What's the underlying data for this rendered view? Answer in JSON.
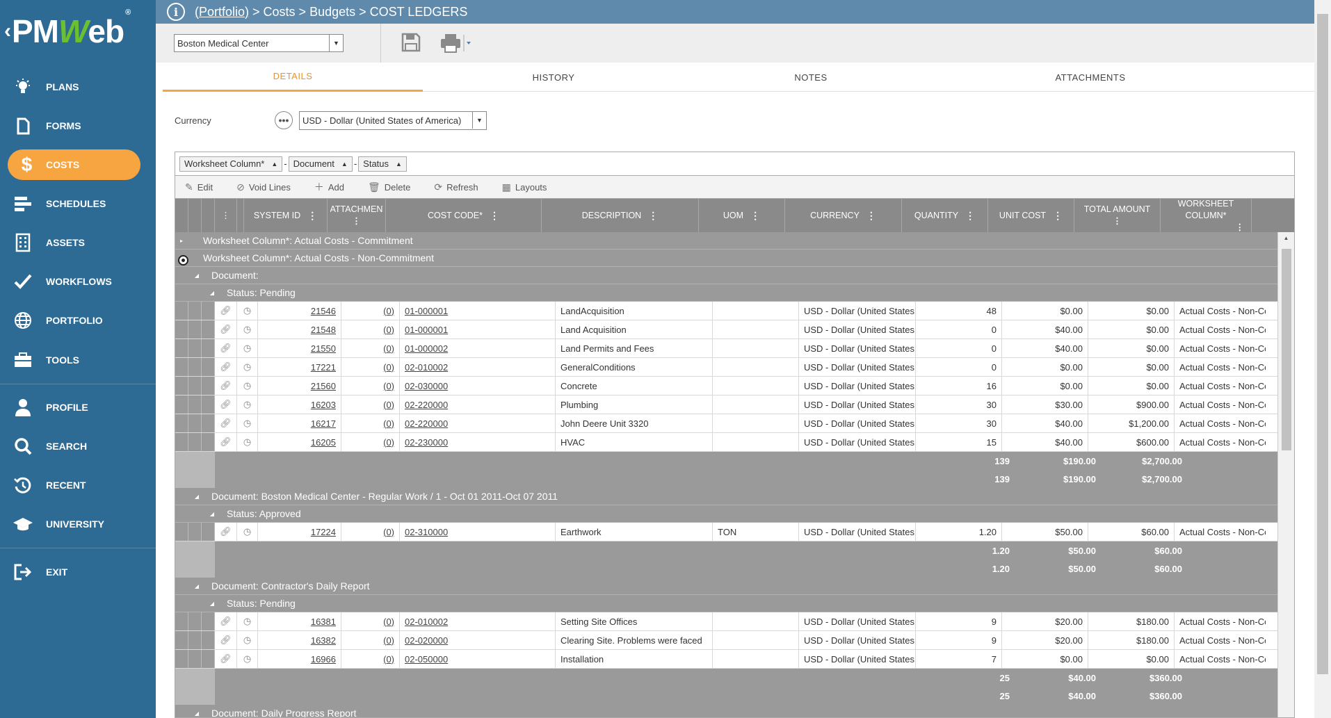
{
  "sidebar": {
    "logo": {
      "prefix": "PM",
      "accent": "W",
      "suffix": "eb",
      "reg": "®"
    },
    "items": [
      {
        "label": "PLANS",
        "icon": "lightbulb-icon"
      },
      {
        "label": "FORMS",
        "icon": "document-icon"
      },
      {
        "label": "COSTS",
        "icon": "dollar-icon",
        "active": true
      },
      {
        "label": "SCHEDULES",
        "icon": "schedule-bars-icon"
      },
      {
        "label": "ASSETS",
        "icon": "building-icon"
      },
      {
        "label": "WORKFLOWS",
        "icon": "checkmark-icon"
      },
      {
        "label": "PORTFOLIO",
        "icon": "globe-icon"
      },
      {
        "label": "TOOLS",
        "icon": "briefcase-icon"
      },
      {
        "label": "PROFILE",
        "icon": "person-icon"
      },
      {
        "label": "SEARCH",
        "icon": "search-icon"
      },
      {
        "label": "RECENT",
        "icon": "history-icon"
      },
      {
        "label": "UNIVERSITY",
        "icon": "graduation-cap-icon"
      },
      {
        "label": "EXIT",
        "icon": "exit-icon"
      }
    ]
  },
  "breadcrumb": {
    "portfolio": "(Portfolio)",
    "rest": " > Costs > Budgets > COST LEDGERS"
  },
  "toolbar": {
    "project": "Boston Medical Center"
  },
  "tabs": [
    "DETAILS",
    "HISTORY",
    "NOTES",
    "ATTACHMENTS"
  ],
  "currency": {
    "label": "Currency",
    "value": "USD - Dollar (United States of America)"
  },
  "grid": {
    "group_chips": [
      "Worksheet Column*",
      "Document",
      "Status"
    ],
    "actions": [
      "Edit",
      "Void Lines",
      "Add",
      "Delete",
      "Refresh",
      "Layouts"
    ],
    "columns": [
      "SYSTEM ID",
      "ATTACHMENTS",
      "COST CODE*",
      "DESCRIPTION",
      "UOM",
      "CURRENCY",
      "QUANTITY",
      "UNIT COST",
      "TOTAL AMOUNT",
      "WORKSHEET COLUMN*"
    ],
    "groups": {
      "ws1": "Worksheet Column*: Actual Costs - Commitment",
      "ws2": "Worksheet Column*: Actual Costs - Non-Commitment",
      "doc1": "Document:",
      "st1": "Status: Pending",
      "doc2": "Document: Boston Medical Center - Regular Work / 1 - Oct 01 2011-Oct 07 2011",
      "st2": "Status: Approved",
      "doc3": "Document: Contractor's Daily Report",
      "st3": "Status: Pending",
      "doc4": "Document: Daily Progress Report"
    },
    "section1": [
      {
        "id": "21546",
        "att": "(0)",
        "code": "01-000001",
        "desc": "LandAcquisition",
        "uom": "",
        "cur": "USD - Dollar (United States of America)",
        "qty": "48",
        "unit": "$0.00",
        "total": "$0.00",
        "ws": "Actual Costs - Non-Commitment"
      },
      {
        "id": "21548",
        "att": "(0)",
        "code": "01-000001",
        "desc": "Land Acquisition",
        "uom": "",
        "cur": "USD - Dollar (United States of America)",
        "qty": "0",
        "unit": "$40.00",
        "total": "$0.00",
        "ws": "Actual Costs - Non-Commitment"
      },
      {
        "id": "21550",
        "att": "(0)",
        "code": "01-000002",
        "desc": "Land Permits and Fees",
        "uom": "",
        "cur": "USD - Dollar (United States of America)",
        "qty": "0",
        "unit": "$40.00",
        "total": "$0.00",
        "ws": "Actual Costs - Non-Commitment"
      },
      {
        "id": "17221",
        "att": "(0)",
        "code": "02-010002",
        "desc": "GeneralConditions",
        "uom": "",
        "cur": "USD - Dollar (United States of America)",
        "qty": "0",
        "unit": "$0.00",
        "total": "$0.00",
        "ws": "Actual Costs - Non-Commitment"
      },
      {
        "id": "21560",
        "att": "(0)",
        "code": "02-030000",
        "desc": "Concrete",
        "uom": "",
        "cur": "USD - Dollar (United States of America)",
        "qty": "16",
        "unit": "$0.00",
        "total": "$0.00",
        "ws": "Actual Costs - Non-Commitment"
      },
      {
        "id": "16203",
        "att": "(0)",
        "code": "02-220000",
        "desc": "Plumbing",
        "uom": "",
        "cur": "USD - Dollar (United States of America)",
        "qty": "30",
        "unit": "$30.00",
        "total": "$900.00",
        "ws": "Actual Costs - Non-Commitment"
      },
      {
        "id": "16217",
        "att": "(0)",
        "code": "02-220000",
        "desc": "John Deere Unit 3320",
        "uom": "",
        "cur": "USD - Dollar (United States of America)",
        "qty": "30",
        "unit": "$40.00",
        "total": "$1,200.00",
        "ws": "Actual Costs - Non-Commitment"
      },
      {
        "id": "16205",
        "att": "(0)",
        "code": "02-230000",
        "desc": "HVAC",
        "uom": "",
        "cur": "USD - Dollar (United States of America)",
        "qty": "15",
        "unit": "$40.00",
        "total": "$600.00",
        "ws": "Actual Costs - Non-Commitment"
      }
    ],
    "section1_summary": {
      "qty": "139",
      "unit": "$190.00",
      "total": "$2,700.00"
    },
    "section2": [
      {
        "id": "17224",
        "att": "(0)",
        "code": "02-310000",
        "desc": "Earthwork",
        "uom": "TON",
        "cur": "USD - Dollar (United States of America)",
        "qty": "1.20",
        "unit": "$50.00",
        "total": "$60.00",
        "ws": "Actual Costs - Non-Commitment"
      }
    ],
    "section2_summary": {
      "qty": "1.20",
      "unit": "$50.00",
      "total": "$60.00"
    },
    "section3": [
      {
        "id": "16381",
        "att": "(0)",
        "code": "02-010002",
        "desc": "Setting Site Offices",
        "uom": "",
        "cur": "USD - Dollar (United States of America)",
        "qty": "9",
        "unit": "$20.00",
        "total": "$180.00",
        "ws": "Actual Costs - Non-Commitment"
      },
      {
        "id": "16382",
        "att": "(0)",
        "code": "02-020000",
        "desc": "Clearing Site. Problems were faced",
        "uom": "",
        "cur": "USD - Dollar (United States of America)",
        "qty": "9",
        "unit": "$20.00",
        "total": "$180.00",
        "ws": "Actual Costs - Non-Commitment"
      },
      {
        "id": "16966",
        "att": "(0)",
        "code": "02-050000",
        "desc": "Installation",
        "uom": "",
        "cur": "USD - Dollar (United States of America)",
        "qty": "7",
        "unit": "$0.00",
        "total": "$0.00",
        "ws": "Actual Costs - Non-Commitment"
      }
    ],
    "section3_summary": {
      "qty": "25",
      "unit": "$40.00",
      "total": "$360.00"
    }
  },
  "colors": {
    "sidebar": "#2d6b94",
    "accent": "#f7a541",
    "header": "#5f8aab",
    "grid_header": "#8a8a8a",
    "group_row": "#9a9a9a"
  }
}
